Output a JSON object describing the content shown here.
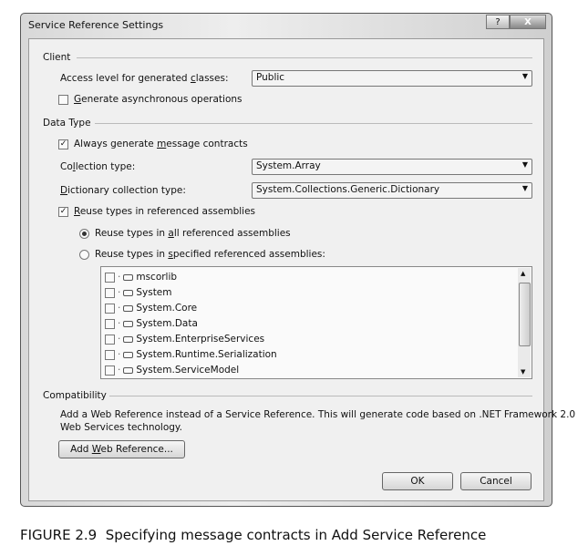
{
  "window": {
    "title": "Service Reference Settings",
    "help_label": "?",
    "close_label": "X"
  },
  "client": {
    "group_label": "Client",
    "access_level": {
      "label_pre": "Access level for generated ",
      "label_key": "c",
      "label_post": "lasses:",
      "value": "Public"
    },
    "async": {
      "label_pre": "",
      "label_key": "G",
      "label_post": "enerate asynchronous operations",
      "checked": false
    }
  },
  "data_type": {
    "group_label": "Data Type",
    "message_contracts": {
      "label_pre": "Always generate ",
      "label_key": "m",
      "label_post": "essage contracts",
      "checked": true
    },
    "collection_type": {
      "label_pre": "Co",
      "label_key": "l",
      "label_post": "lection type:",
      "value": "System.Array"
    },
    "dictionary_type": {
      "label_pre": "",
      "label_key": "D",
      "label_post": "ictionary collection type:",
      "value": "System.Collections.Generic.Dictionary"
    },
    "reuse_types": {
      "label_pre": "",
      "label_key": "R",
      "label_post": "euse types in referenced assemblies",
      "checked": true
    },
    "reuse_all": {
      "label_pre": "Reuse types in ",
      "label_key": "a",
      "label_post": "ll referenced assemblies",
      "selected": true
    },
    "reuse_specified": {
      "label_pre": "Reuse types in ",
      "label_key": "s",
      "label_post": "pecified referenced assemblies:",
      "selected": false
    },
    "assemblies": [
      "mscorlib",
      "System",
      "System.Core",
      "System.Data",
      "System.EnterpriseServices",
      "System.Runtime.Serialization",
      "System.ServiceModel"
    ]
  },
  "compatibility": {
    "group_label": "Compatibility",
    "description_line1": "Add a Web Reference instead of a Service Reference. This will generate code based on .NET Framework 2.0",
    "description_line2": "Web Services technology.",
    "button": {
      "label_pre": "Add ",
      "label_key": "W",
      "label_post": "eb Reference..."
    }
  },
  "footer": {
    "ok_label": "OK",
    "cancel_label": "Cancel"
  },
  "caption": {
    "figure": "FIGURE 2.9",
    "text": "Specifying message contracts in Add Service Reference"
  }
}
